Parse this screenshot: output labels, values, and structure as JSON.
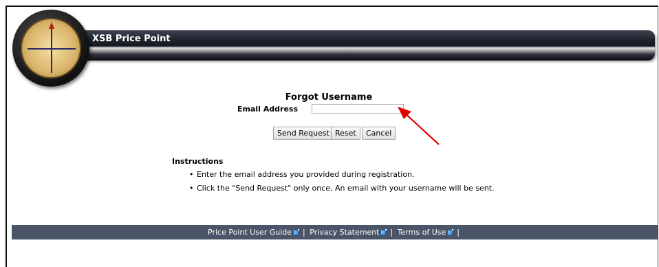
{
  "header": {
    "app_title": "XSB Price Point",
    "logo_icon": "compass-icon"
  },
  "form": {
    "title": "Forgot Username",
    "email_label": "Email Address",
    "email_value": "",
    "email_placeholder": "",
    "buttons": {
      "send": "Send Request",
      "reset": "Reset",
      "cancel": "Cancel"
    }
  },
  "instructions": {
    "heading": "Instructions",
    "items": [
      "Enter the email address you provided during registration.",
      "Click the \"Send Request\" only once. An email with your username will be sent."
    ]
  },
  "footer": {
    "links": [
      "Price Point User Guide",
      "Privacy Statement",
      "Terms of Use"
    ],
    "separator": "|",
    "link_icon": "external-link-icon",
    "background": "#4a5568"
  },
  "annotation": {
    "arrow_color": "#e00000"
  }
}
